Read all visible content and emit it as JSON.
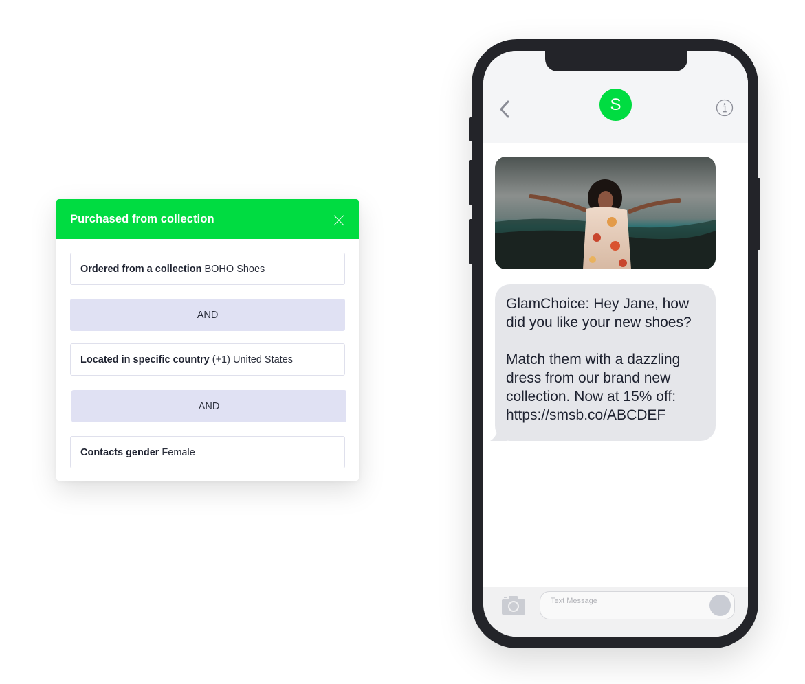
{
  "segment_panel": {
    "title": "Purchased from collection",
    "close_icon": "close-icon",
    "header_color": "#00dc41",
    "conditions": [
      {
        "label": "Ordered from a collection",
        "value": "BOHO Shoes"
      },
      {
        "label": "Located in specific country",
        "value": "(+1) United States"
      },
      {
        "label": "Contacts gender",
        "value": "Female"
      }
    ],
    "operators": [
      "AND",
      "AND"
    ]
  },
  "phone": {
    "header": {
      "back_icon": "chevron-left-icon",
      "avatar_letter": "S",
      "avatar_color": "#00dc41",
      "info_icon": "info-icon"
    },
    "message_image": {
      "description": "Woman in floral dress with outstretched arms, stormy sky and hills"
    },
    "message_text": "GlamChoice:  Hey Jane, how did you like your new shoes?\n\nMatch them with a dazzling dress from our brand new collection. Now at 15% off: https://smsb.co/ABCDEF",
    "composer": {
      "camera_icon": "camera-icon",
      "placeholder": "Text Message",
      "send_icon": "send-button"
    }
  }
}
